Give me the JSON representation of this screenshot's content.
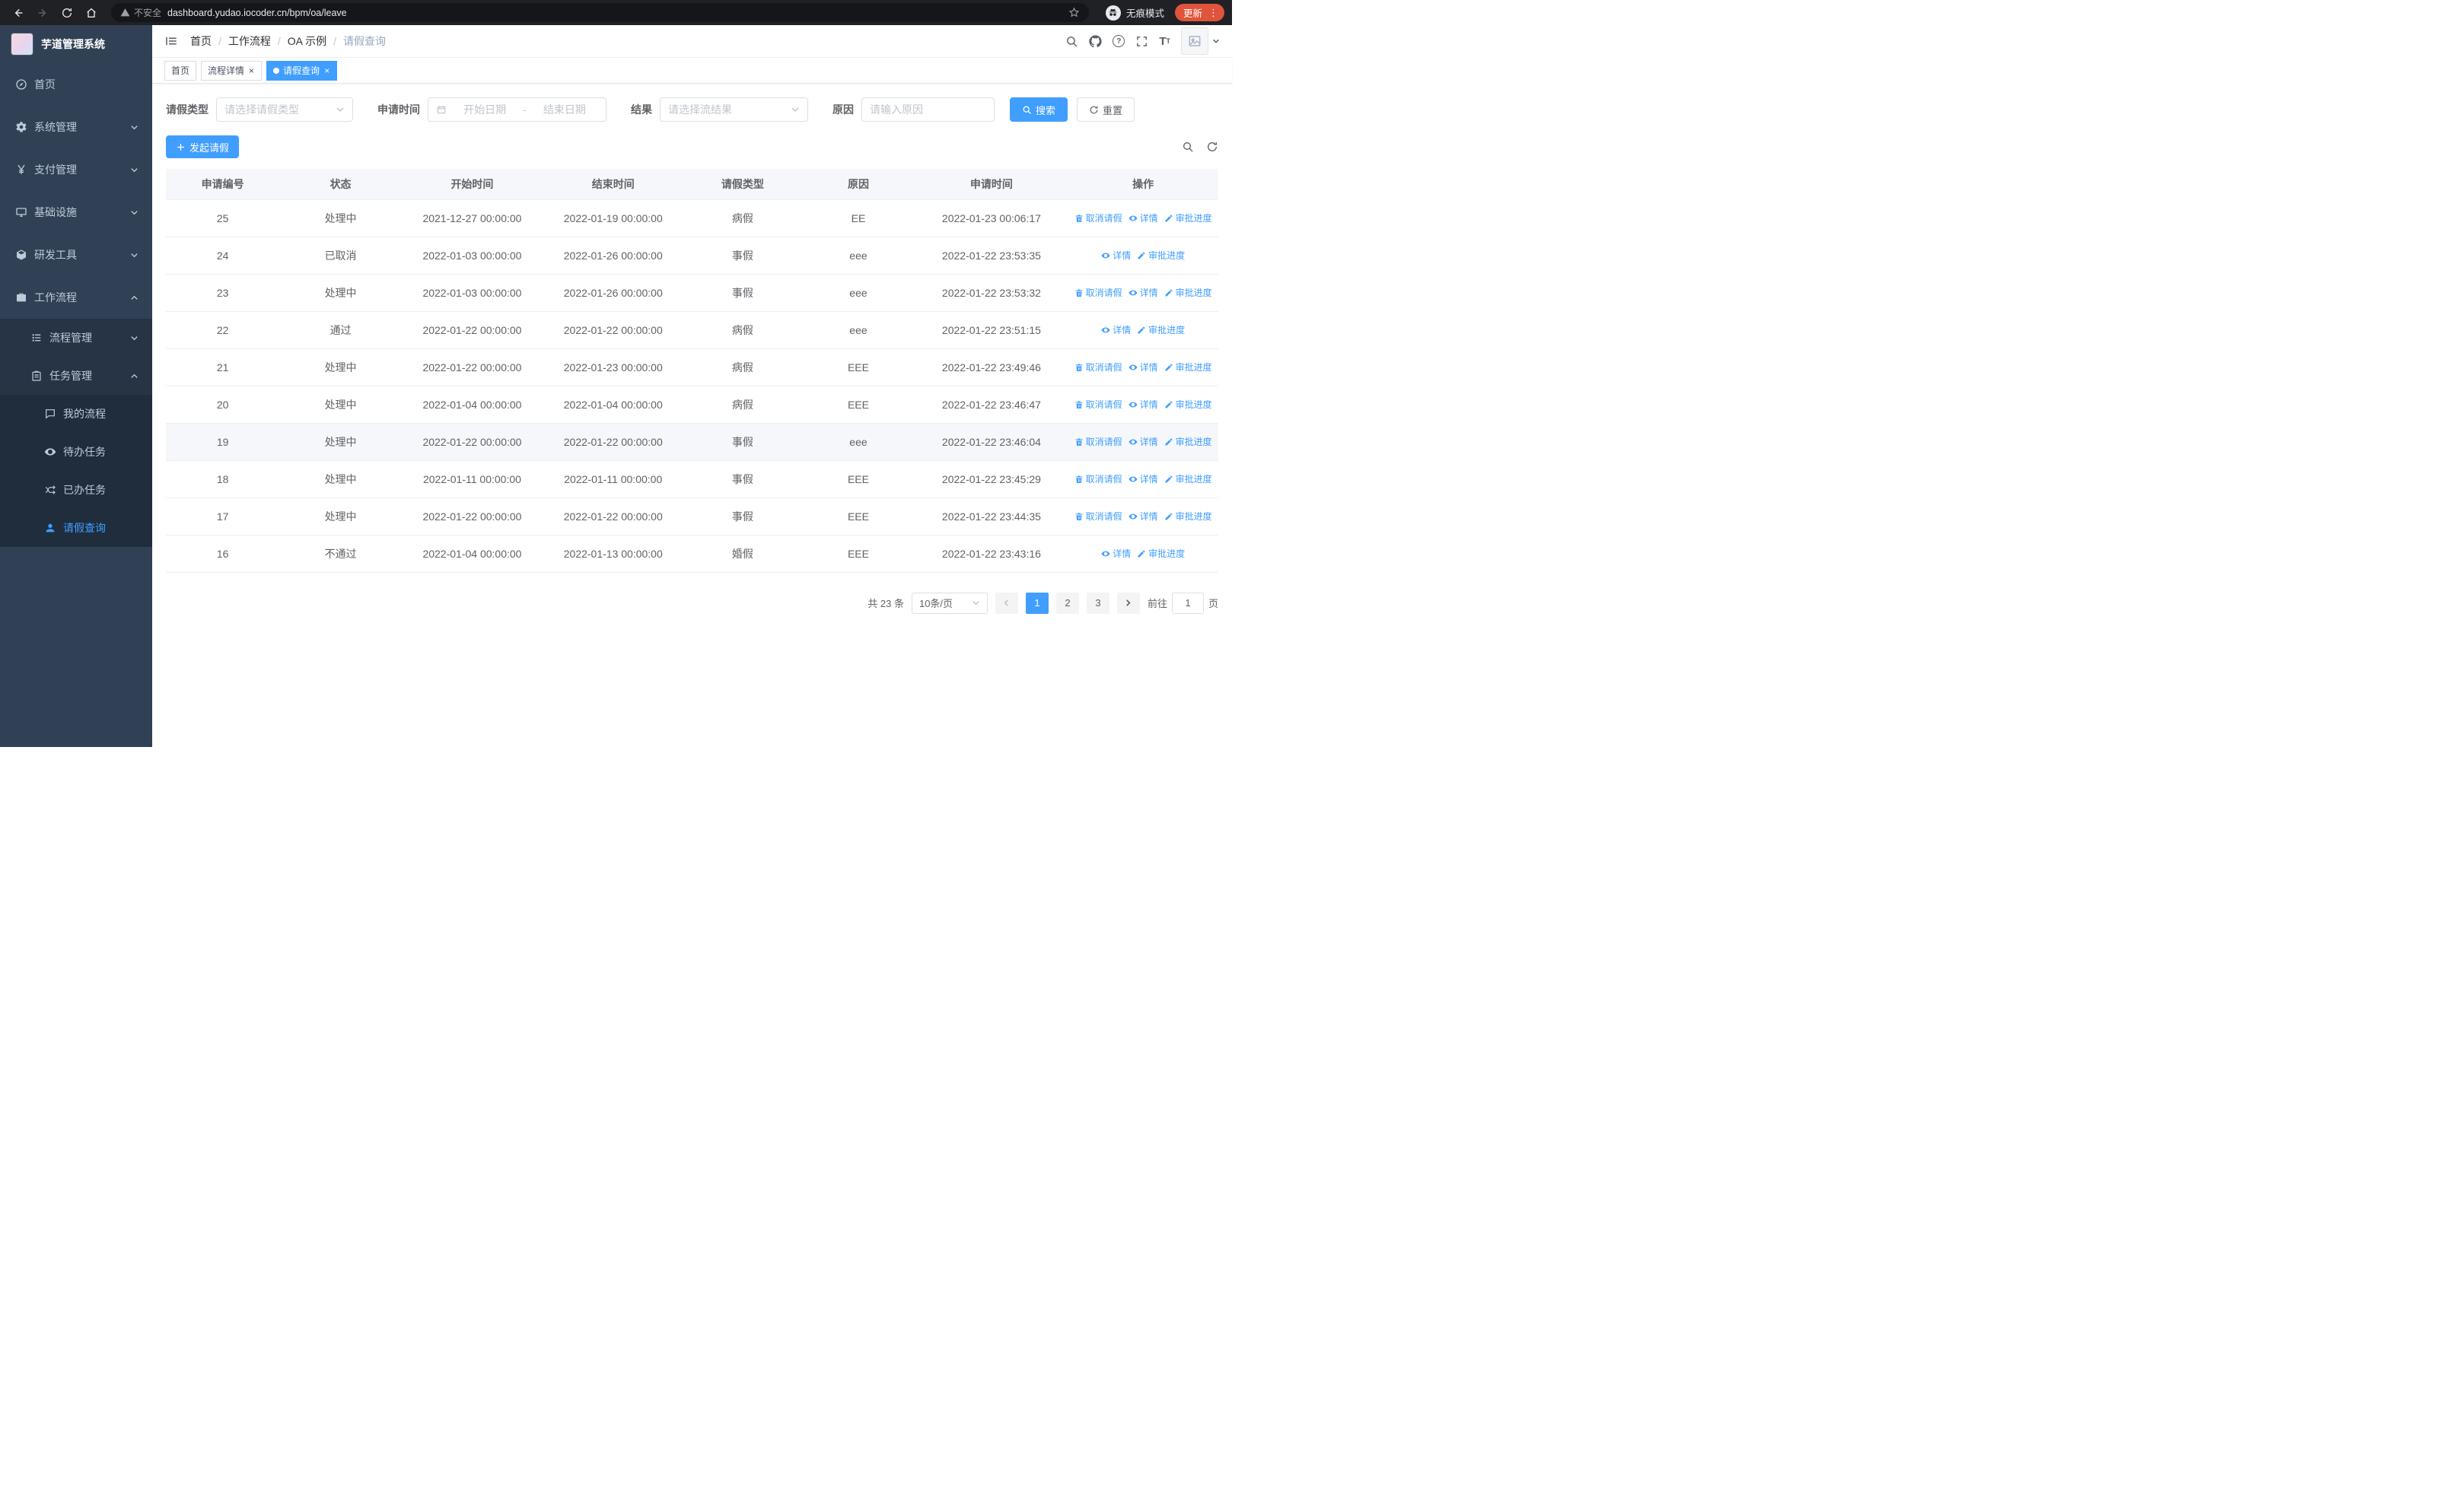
{
  "colors": {
    "accent": "#409eff",
    "sidebar_bg": "#304156",
    "sidebar_sub_bg": "#263445",
    "sidebar_deep_bg": "#1f2d3d"
  },
  "browser": {
    "security_label": "不安全",
    "url": "dashboard.yudao.iocoder.cn/bpm/oa/leave",
    "incognito_label": "无痕模式",
    "update_label": "更新"
  },
  "sidebar": {
    "logo_title": "芋道管理系统",
    "menu": [
      {
        "label": "首页",
        "icon": "dashboard-icon"
      },
      {
        "label": "系统管理",
        "icon": "gear-icon"
      },
      {
        "label": "支付管理",
        "icon": "yen-icon"
      },
      {
        "label": "基础设施",
        "icon": "monitor-icon"
      },
      {
        "label": "研发工具",
        "icon": "cube-icon"
      },
      {
        "label": "工作流程",
        "icon": "briefcase-icon"
      },
      {
        "label": "流程管理",
        "icon": "list-tree-icon"
      },
      {
        "label": "任务管理",
        "icon": "clipboard-icon"
      },
      {
        "label": "我的流程",
        "icon": "chat-icon"
      },
      {
        "label": "待办任务",
        "icon": "eye-icon"
      },
      {
        "label": "已办任务",
        "icon": "shuffle-icon"
      },
      {
        "label": "请假查询",
        "icon": "person-icon"
      }
    ]
  },
  "breadcrumb": [
    "首页",
    "工作流程",
    "OA 示例",
    "请假查询"
  ],
  "tabs": [
    {
      "label": "首页"
    },
    {
      "label": "流程详情"
    },
    {
      "label": "请假查询"
    }
  ],
  "filters": {
    "leave_type_label": "请假类型",
    "leave_type_placeholder": "请选择请假类型",
    "apply_time_label": "申请时间",
    "date_start_placeholder": "开始日期",
    "date_separator": "-",
    "date_end_placeholder": "结束日期",
    "result_label": "结果",
    "result_placeholder": "请选择流结果",
    "reason_label": "原因",
    "reason_placeholder": "请输入原因",
    "search_label": "搜索",
    "reset_label": "重置"
  },
  "toolbar": {
    "create_label": "发起请假"
  },
  "table": {
    "columns": [
      "申请编号",
      "状态",
      "开始时间",
      "结束时间",
      "请假类型",
      "原因",
      "申请时间",
      "操作"
    ],
    "action_defs": {
      "cancel": {
        "label": "取消请假",
        "icon": "delete-icon"
      },
      "detail": {
        "label": "详情",
        "icon": "view-icon"
      },
      "progress": {
        "label": "审批进度",
        "icon": "edit-icon"
      }
    },
    "rows": [
      {
        "id": "25",
        "status": "处理中",
        "start_time": "2021-12-27 00:00:00",
        "end_time": "2022-01-19 00:00:00",
        "leave_type": "病假",
        "reason": "EE",
        "apply_time": "2022-01-23 00:06:17",
        "actions": [
          "cancel",
          "detail",
          "progress"
        ]
      },
      {
        "id": "24",
        "status": "已取消",
        "start_time": "2022-01-03 00:00:00",
        "end_time": "2022-01-26 00:00:00",
        "leave_type": "事假",
        "reason": "eee",
        "apply_time": "2022-01-22 23:53:35",
        "actions": [
          "detail",
          "progress"
        ]
      },
      {
        "id": "23",
        "status": "处理中",
        "start_time": "2022-01-03 00:00:00",
        "end_time": "2022-01-26 00:00:00",
        "leave_type": "事假",
        "reason": "eee",
        "apply_time": "2022-01-22 23:53:32",
        "actions": [
          "cancel",
          "detail",
          "progress"
        ]
      },
      {
        "id": "22",
        "status": "通过",
        "start_time": "2022-01-22 00:00:00",
        "end_time": "2022-01-22 00:00:00",
        "leave_type": "病假",
        "reason": "eee",
        "apply_time": "2022-01-22 23:51:15",
        "actions": [
          "detail",
          "progress"
        ]
      },
      {
        "id": "21",
        "status": "处理中",
        "start_time": "2022-01-22 00:00:00",
        "end_time": "2022-01-23 00:00:00",
        "leave_type": "病假",
        "reason": "EEE",
        "apply_time": "2022-01-22 23:49:46",
        "actions": [
          "cancel",
          "detail",
          "progress"
        ]
      },
      {
        "id": "20",
        "status": "处理中",
        "start_time": "2022-01-04 00:00:00",
        "end_time": "2022-01-04 00:00:00",
        "leave_type": "病假",
        "reason": "EEE",
        "apply_time": "2022-01-22 23:46:47",
        "actions": [
          "cancel",
          "detail",
          "progress"
        ]
      },
      {
        "id": "19",
        "status": "处理中",
        "start_time": "2022-01-22 00:00:00",
        "end_time": "2022-01-22 00:00:00",
        "leave_type": "事假",
        "reason": "eee",
        "apply_time": "2022-01-22 23:46:04",
        "actions": [
          "cancel",
          "detail",
          "progress"
        ]
      },
      {
        "id": "18",
        "status": "处理中",
        "start_time": "2022-01-11 00:00:00",
        "end_time": "2022-01-11 00:00:00",
        "leave_type": "事假",
        "reason": "EEE",
        "apply_time": "2022-01-22 23:45:29",
        "actions": [
          "cancel",
          "detail",
          "progress"
        ]
      },
      {
        "id": "17",
        "status": "处理中",
        "start_time": "2022-01-22 00:00:00",
        "end_time": "2022-01-22 00:00:00",
        "leave_type": "事假",
        "reason": "EEE",
        "apply_time": "2022-01-22 23:44:35",
        "actions": [
          "cancel",
          "detail",
          "progress"
        ]
      },
      {
        "id": "16",
        "status": "不通过",
        "start_time": "2022-01-04 00:00:00",
        "end_time": "2022-01-13 00:00:00",
        "leave_type": "婚假",
        "reason": "EEE",
        "apply_time": "2022-01-22 23:43:16",
        "actions": [
          "detail",
          "progress"
        ]
      }
    ]
  },
  "pagination": {
    "total_text": "共 23 条",
    "page_size": "10条/页",
    "pages": [
      "1",
      "2",
      "3"
    ],
    "active_page": "1",
    "goto_label": "前往",
    "goto_value": "1",
    "page_suffix": "页"
  }
}
